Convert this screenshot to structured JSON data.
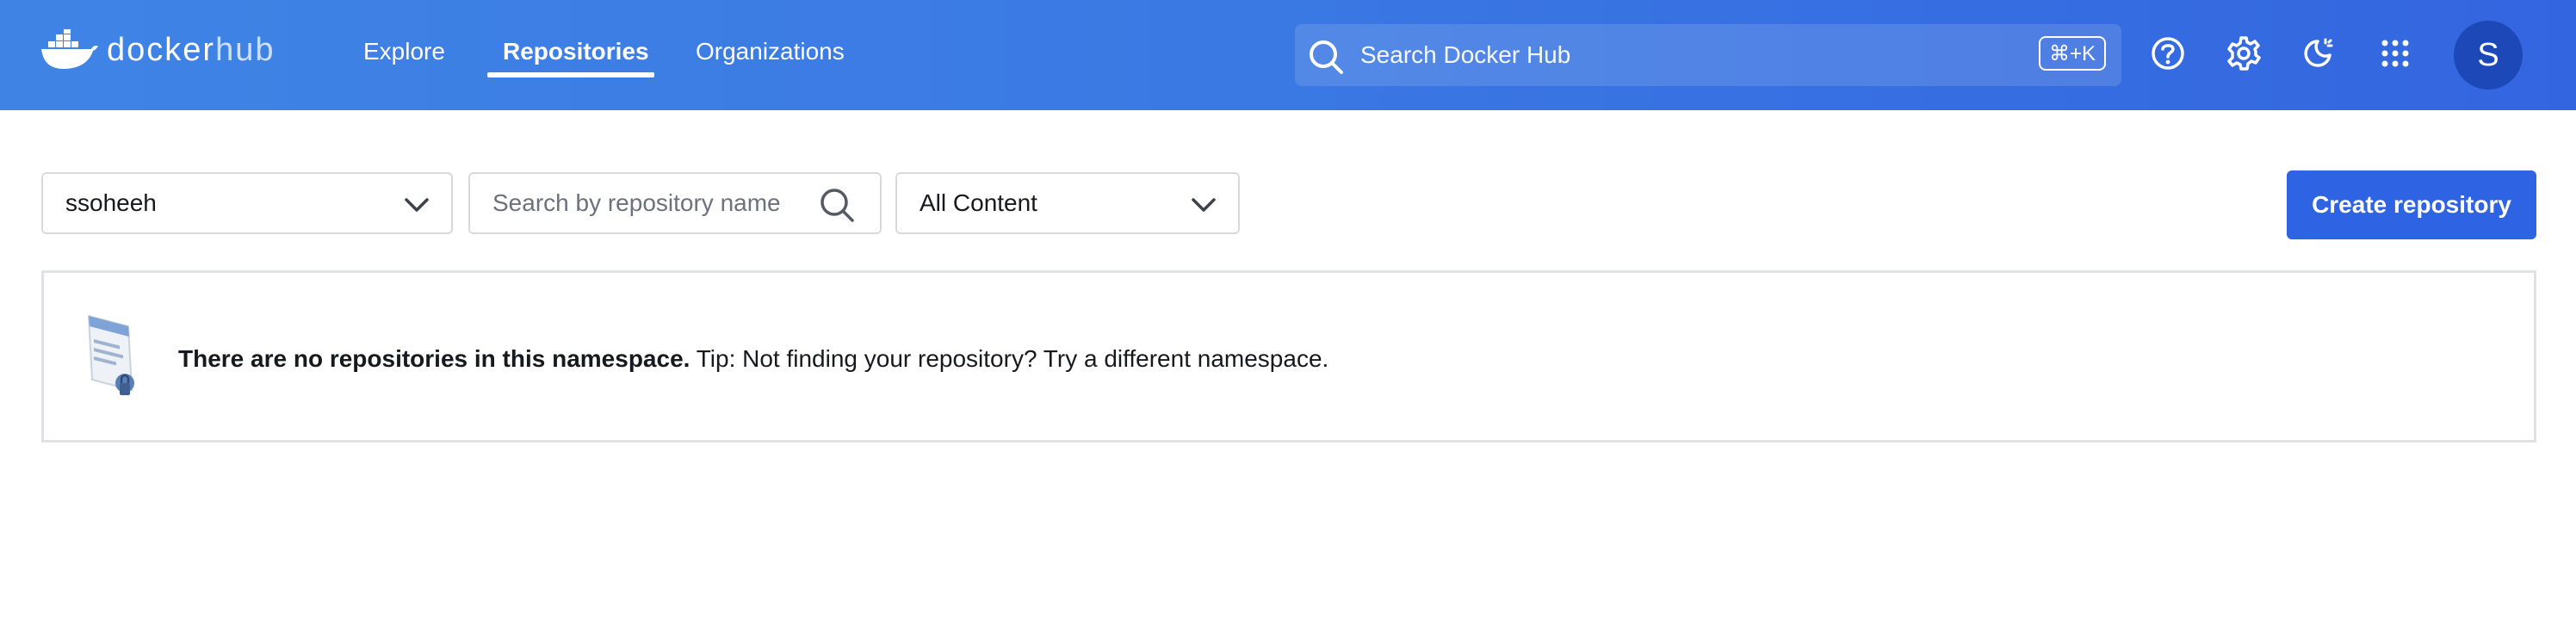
{
  "header": {
    "logo_word": "docker",
    "logo_hub": "hub",
    "nav": {
      "explore": "Explore",
      "repositories": "Repositories",
      "organizations": "Organizations"
    },
    "active_tab": "Repositories",
    "search_placeholder": "Search Docker Hub",
    "search_shortcut": "⌘+K",
    "icons": [
      "help-icon",
      "gear-icon",
      "theme-toggle-icon",
      "apps-grid-icon"
    ],
    "avatar_initial": "S"
  },
  "filters": {
    "namespace_value": "ssoheeh",
    "repo_search_placeholder": "Search by repository name",
    "content_value": "All Content"
  },
  "actions": {
    "create_label": "Create repository"
  },
  "empty_state": {
    "title": "There are no repositories in this namespace.",
    "tip": " Tip: Not finding your repository? Try a different namespace."
  },
  "colors": {
    "header_gradient_start": "#3f84e5",
    "header_gradient_end": "#3365e0",
    "primary_button": "#2e64e4",
    "avatar_bg": "#1c48b8"
  }
}
